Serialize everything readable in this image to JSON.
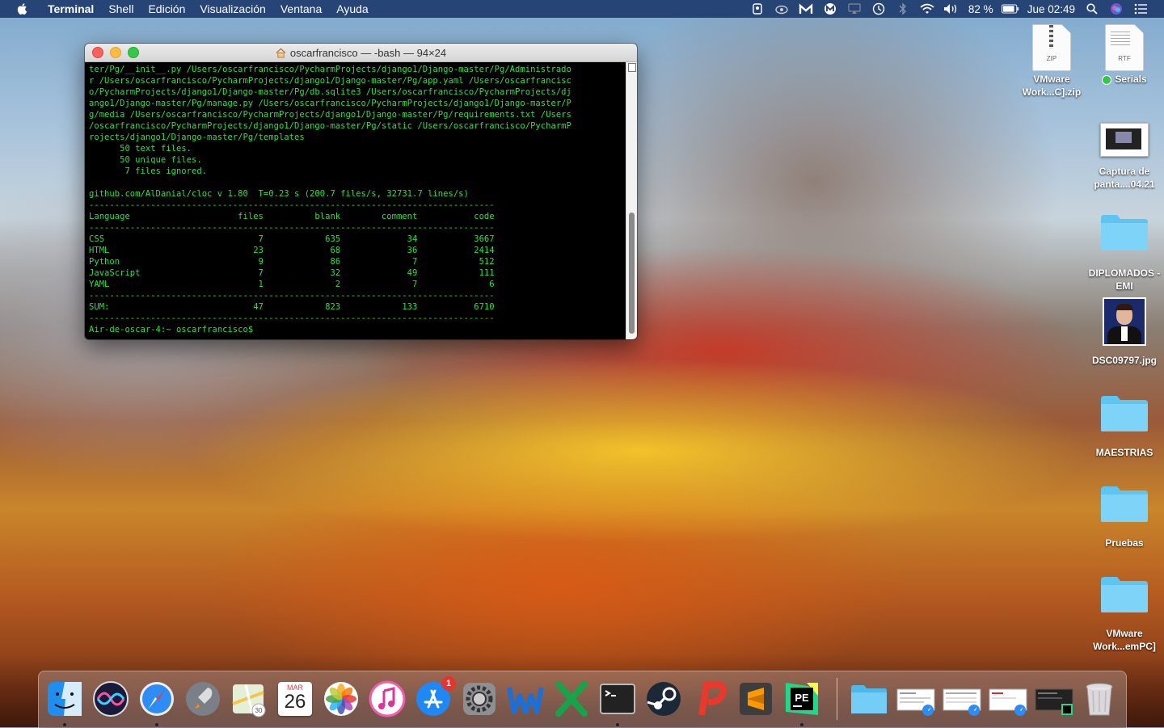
{
  "menubar": {
    "app_name": "Terminal",
    "menus": [
      "Shell",
      "Edición",
      "Visualización",
      "Ventana",
      "Ayuda"
    ],
    "battery": "82 %",
    "clock": "Jue 02:49",
    "status_icons": [
      "keychain-icon",
      "cloud-icon",
      "malwarebytes-icon",
      "m-icon",
      "airplay-icon",
      "time-machine-icon",
      "bluetooth-icon",
      "wifi-icon",
      "volume-icon",
      "battery-icon",
      "spotlight-icon",
      "siri-icon",
      "notification-center-icon"
    ]
  },
  "terminal": {
    "title": "oscarfrancisco — -bash — 94×24",
    "lines": [
      "ter/Pg/__init__.py /Users/oscarfrancisco/PycharmProjects/django1/Django-master/Pg/Administrado",
      "r /Users/oscarfrancisco/PycharmProjects/django1/Django-master/Pg/app.yaml /Users/oscarfrancisc",
      "o/PycharmProjects/django1/Django-master/Pg/db.sqlite3 /Users/oscarfrancisco/PycharmProjects/dj",
      "ango1/Django-master/Pg/manage.py /Users/oscarfrancisco/PycharmProjects/django1/Django-master/P",
      "g/media /Users/oscarfrancisco/PycharmProjects/django1/Django-master/Pg/requirements.txt /Users",
      "/oscarfrancisco/PycharmProjects/django1/Django-master/Pg/static /Users/oscarfrancisco/PycharmP",
      "rojects/django1/Django-master/Pg/templates",
      "      50 text files.",
      "      50 unique files.",
      "       7 files ignored.",
      "",
      "github.com/AlDanial/cloc v 1.80  T=0.23 s (200.7 files/s, 32731.7 lines/s)",
      "-------------------------------------------------------------------------------",
      "Language                     files          blank        comment           code",
      "-------------------------------------------------------------------------------",
      "CSS                              7            635             34           3667",
      "HTML                            23             68             36           2414",
      "Python                           9             86              7            512",
      "JavaScript                       7             32             49            111",
      "YAML                             1              2              7              6",
      "-------------------------------------------------------------------------------",
      "SUM:                            47            823            133           6710",
      "-------------------------------------------------------------------------------",
      "Air-de-oscar-4:~ oscarfrancisco$ "
    ]
  },
  "desktop_icons": [
    {
      "label": "VMware Work...C].zip",
      "kind": "ZIP"
    },
    {
      "label": "Serials",
      "kind": "RTF"
    },
    {
      "label": "Captura de panta....04.21"
    },
    {
      "label": "DIPLOMADOS - EMI"
    },
    {
      "label": "DSC09797.jpg"
    },
    {
      "label": "MAESTRIAS"
    },
    {
      "label": "Pruebas"
    },
    {
      "label": "VMware Work...emPC]"
    }
  ],
  "dock": {
    "calendar_month": "MAR",
    "calendar_day": "26",
    "app_store_badge": "1",
    "apps": [
      "Finder",
      "Siri",
      "Safari",
      "Launchpad",
      "Maps",
      "Calendar",
      "Photos",
      "iTunes",
      "App Store",
      "System Preferences",
      "Word",
      "Excel",
      "Terminal",
      "Steam",
      "WPS Presentation",
      "Sublime Text",
      "PyCharm Edu"
    ]
  }
}
